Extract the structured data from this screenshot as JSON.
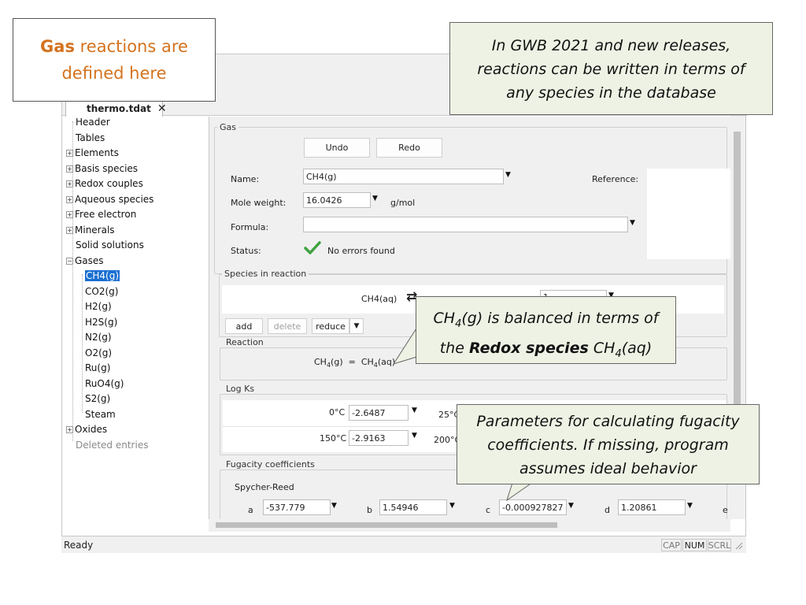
{
  "callouts": {
    "gas_defined_bold": "Gas",
    "gas_defined_rest_1": " reactions are",
    "gas_defined_rest_2": "defined here",
    "gwb_line1": "In GWB 2021 and new releases,",
    "gwb_line2": "reactions can be written in terms of",
    "gwb_line3": "any species in the database",
    "ch4_pre": "CH",
    "ch4_sub": "4",
    "ch4_line1_rest": "(g) is balanced in terms of",
    "ch4_line2_pre": "the ",
    "ch4_line2_bold": "Redox species",
    "ch4_line2_post_a": " CH",
    "ch4_line2_post_sub": "4",
    "ch4_line2_post_b": "(aq)",
    "params_line1": "Parameters for calculating fugacity",
    "params_line2": "coefficients. If missing, program",
    "params_line3": "assumes ideal behavior"
  },
  "tab": {
    "label": "thermo.tdat",
    "close": "✕"
  },
  "tree": {
    "items": [
      {
        "label": "Header"
      },
      {
        "label": "Tables"
      },
      {
        "label": "Elements"
      },
      {
        "label": "Basis species"
      },
      {
        "label": "Redox couples"
      },
      {
        "label": "Aqueous species"
      },
      {
        "label": "Free electron"
      },
      {
        "label": "Minerals"
      },
      {
        "label": "Solid solutions"
      },
      {
        "label": "Gases"
      },
      {
        "label": "CH4(g)"
      },
      {
        "label": "CO2(g)"
      },
      {
        "label": "H2(g)"
      },
      {
        "label": "H2S(g)"
      },
      {
        "label": "N2(g)"
      },
      {
        "label": "O2(g)"
      },
      {
        "label": "Ru(g)"
      },
      {
        "label": "RuO4(g)"
      },
      {
        "label": "S2(g)"
      },
      {
        "label": "Steam"
      },
      {
        "label": "Oxides"
      },
      {
        "label": "Deleted entries"
      }
    ],
    "plus": "⊞",
    "minus": "⊟"
  },
  "form": {
    "group_gas": "Gas",
    "undo": "Undo",
    "redo": "Redo",
    "name_label": "Name:",
    "name_value": "CH4(g)",
    "reference_label": "Reference:",
    "mole_weight_label": "Mole weight:",
    "mole_weight_value": "16.0426",
    "mole_weight_unit": "g/mol",
    "formula_label": "Formula:",
    "formula_value": "",
    "status_label": "Status:",
    "status_value": "No errors found",
    "species_group": "Species in reaction",
    "species_name": "CH4(aq)",
    "species_arrow": "⇄",
    "species_coef": "1",
    "add": "add",
    "delete": "delete",
    "reduce": "reduce",
    "reaction_group": "Reaction",
    "reaction_left_a": "CH",
    "reaction_left_sub": "4",
    "reaction_left_b": "(g)",
    "reaction_eq": "=",
    "reaction_right_a": "CH",
    "reaction_right_sub": "4",
    "reaction_right_b": "(aq)",
    "logk_group": "Log Ks",
    "logk_t1": "0°C",
    "logk_v1": "-2.6487",
    "logk_t2": "25°C",
    "logk_t3": "150°C",
    "logk_v3": "-2.9163",
    "logk_t4": "200°C",
    "fug_group": "Fugacity coefficients",
    "fug_model": "Spycher-Reed",
    "fug_a_label": "a",
    "fug_a": "-537.779",
    "fug_b_label": "b",
    "fug_b": "1.54946",
    "fug_c_label": "c",
    "fug_c": "-0.000927827",
    "fug_d_label": "d",
    "fug_d": "1.20861",
    "fug_e_label": "e",
    "dropdown_glyph": "▼"
  },
  "statusbar": {
    "text": "Ready",
    "cap": "CAP",
    "num": "NUM",
    "scrl": "SCRL"
  },
  "colors": {
    "accent_orange": "#d4731f",
    "callout_bg": "#eef2e4",
    "selection": "#1a6fd1",
    "check": "#3fa23f"
  }
}
